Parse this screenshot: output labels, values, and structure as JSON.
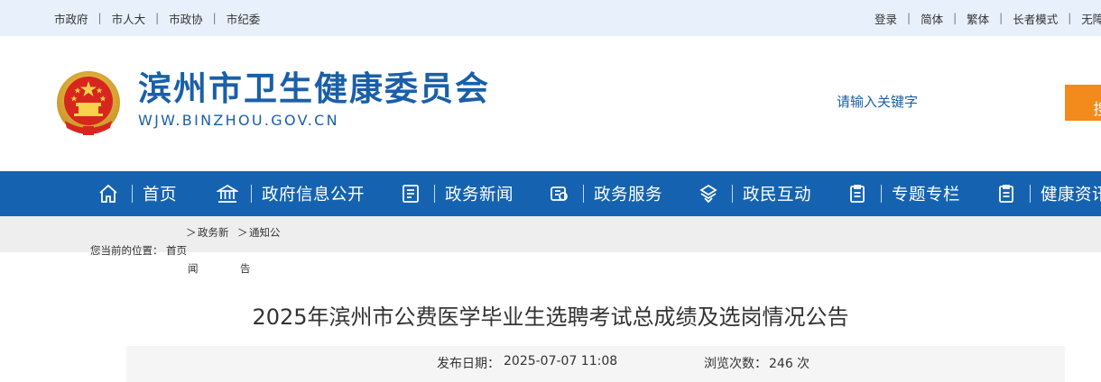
{
  "topbar": {
    "left_links": [
      "市政府",
      "市人大",
      "市政协",
      "市纪委"
    ],
    "right_links": [
      "登录",
      "简体",
      "繁体",
      "长者模式",
      "无障"
    ]
  },
  "header": {
    "title": "滨州市卫生健康委员会",
    "domain": "WJW.BINZHOU.GOV.CN",
    "search_placeholder": "请输入关键字",
    "search_button": "搜"
  },
  "nav": {
    "items": [
      {
        "label": "首页",
        "icon": "home-icon"
      },
      {
        "label": "政府信息公开",
        "icon": "building-icon"
      },
      {
        "label": "政务新闻",
        "icon": "document-icon"
      },
      {
        "label": "政务服务",
        "icon": "service-icon"
      },
      {
        "label": "政民互动",
        "icon": "interaction-icon"
      },
      {
        "label": "专题专栏",
        "icon": "clipboard-icon"
      },
      {
        "label": "健康资讯",
        "icon": "clipboard-icon"
      }
    ]
  },
  "breadcrumb": {
    "prefix": "您当前的位置：",
    "home": "首页",
    "sep": "＞",
    "item1_line1": "政务新",
    "item1_line2": "闻",
    "item2_line1": "通知公",
    "item2_line2": "告"
  },
  "article": {
    "title": "2025年滨州市公费医学毕业生选聘考试总成绩及选岗情况公告",
    "date_label": "发布日期：",
    "date_value": "2025-07-07 11:08",
    "views_label": "浏览次数：",
    "views_value": "246 次"
  },
  "colors": {
    "brand_blue": "#1563b0",
    "title_blue": "#1a5fa8",
    "search_orange": "#f28b1b",
    "topbar_bg": "#e8f0fb"
  }
}
